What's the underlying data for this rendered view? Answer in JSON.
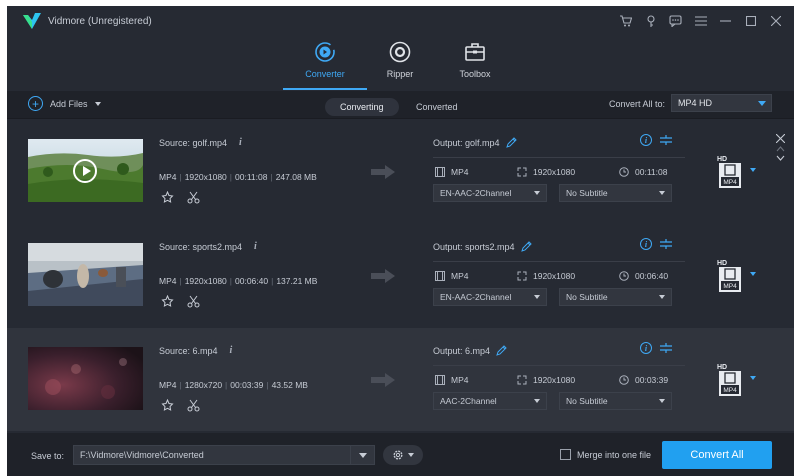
{
  "app": {
    "title": "Vidmore (Unregistered)"
  },
  "tabs": [
    {
      "label": "Converter",
      "icon": "converter-icon",
      "active": true
    },
    {
      "label": "Ripper",
      "icon": "disc-icon",
      "active": false
    },
    {
      "label": "Toolbox",
      "icon": "toolbox-icon",
      "active": false
    }
  ],
  "toolbar": {
    "add_files": "Add Files",
    "converting": "Converting",
    "converted": "Converted",
    "convert_all_to": "Convert All to:",
    "format": "MP4 HD"
  },
  "files": [
    {
      "source": "Source: golf.mp4",
      "format": "MP4",
      "resolution": "1920x1080",
      "duration": "00:11:08",
      "size": "247.08 MB",
      "output": "Output: golf.mp4",
      "out_format": "MP4",
      "out_resolution": "1920x1080",
      "out_duration": "00:11:08",
      "audio": "EN-AAC-2Channel",
      "subtitle": "No Subtitle",
      "format_badge": "MP4",
      "hd_badge": "HD"
    },
    {
      "source": "Source: sports2.mp4",
      "format": "MP4",
      "resolution": "1920x1080",
      "duration": "00:06:40",
      "size": "137.21 MB",
      "output": "Output: sports2.mp4",
      "out_format": "MP4",
      "out_resolution": "1920x1080",
      "out_duration": "00:06:40",
      "audio": "EN-AAC-2Channel",
      "subtitle": "No Subtitle",
      "format_badge": "MP4",
      "hd_badge": "HD"
    },
    {
      "source": "Source: 6.mp4",
      "format": "MP4",
      "resolution": "1280x720",
      "duration": "00:03:39",
      "size": "43.52 MB",
      "output": "Output: 6.mp4",
      "out_format": "MP4",
      "out_resolution": "1920x1080",
      "out_duration": "00:03:39",
      "audio": "AAC-2Channel",
      "subtitle": "No Subtitle",
      "format_badge": "MP4",
      "hd_badge": "HD"
    }
  ],
  "bottom": {
    "save_to": "Save to:",
    "path": "F:\\Vidmore\\Vidmore\\Converted",
    "merge": "Merge into one file",
    "convert_all": "Convert All"
  },
  "colors": {
    "accent": "#3fa9f5",
    "button": "#21a0f0",
    "bg": "#262a33"
  }
}
